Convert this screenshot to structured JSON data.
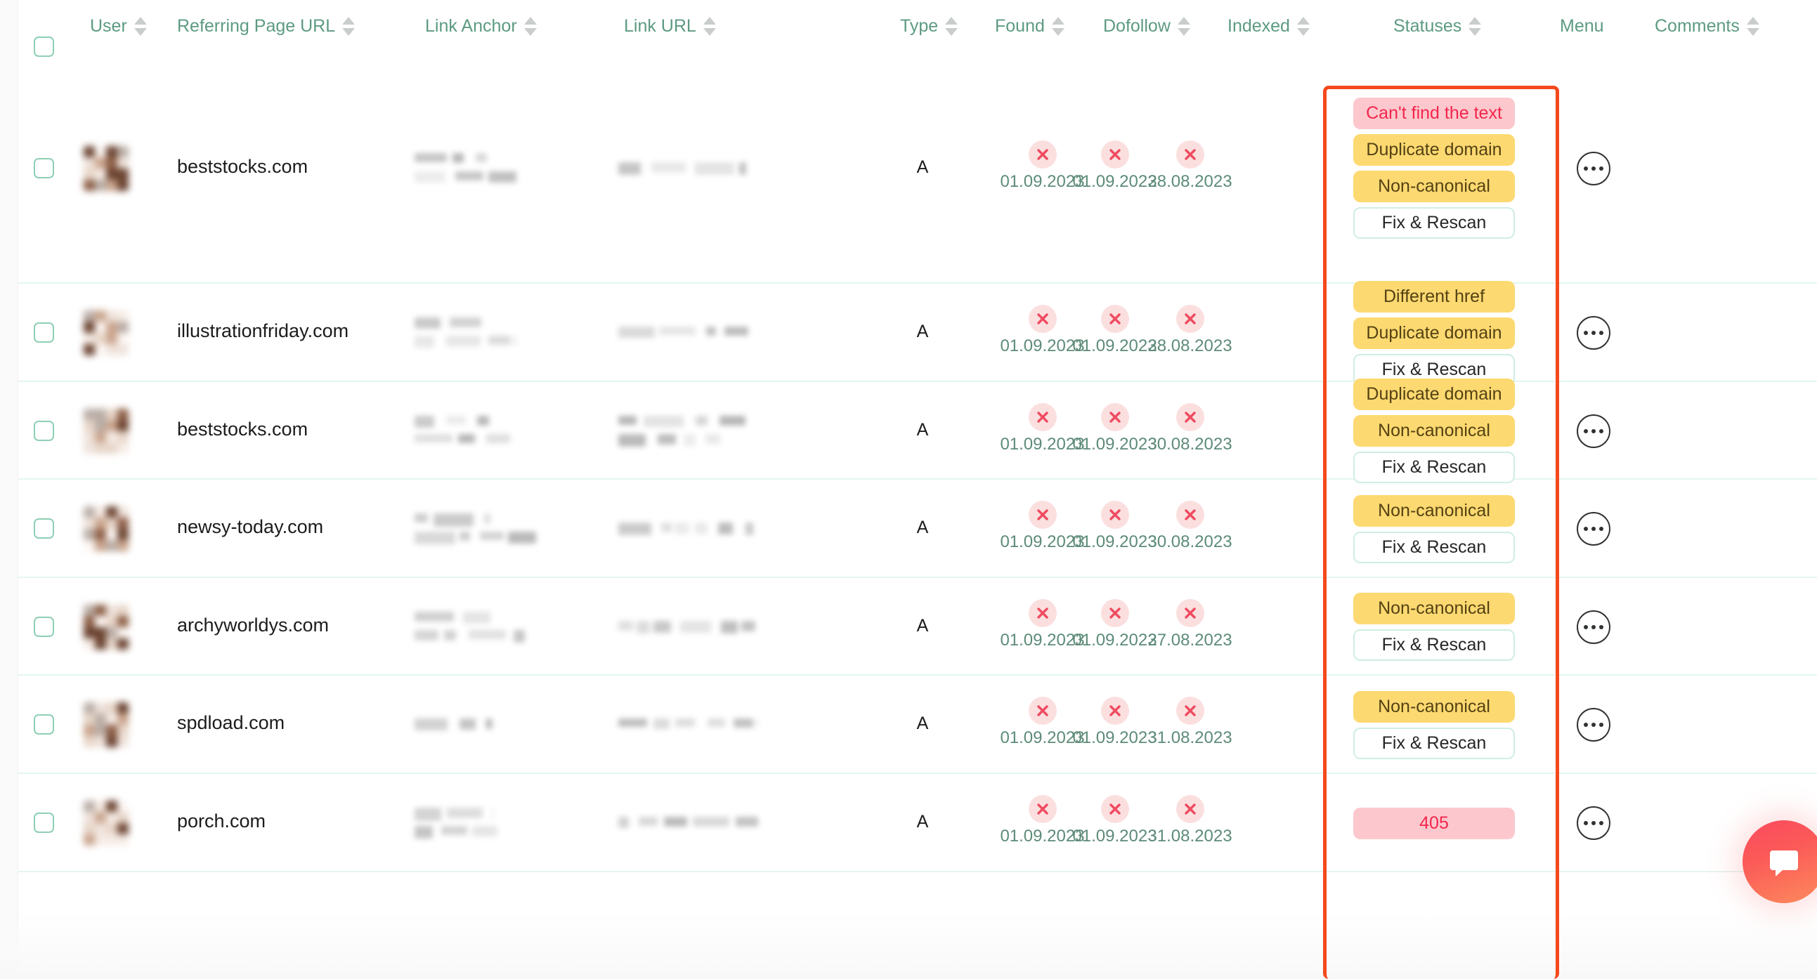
{
  "table": {
    "header": {
      "select_all_checkbox": "select-all",
      "columns": [
        {
          "label": "User",
          "sortable": true
        },
        {
          "label": "Referring Page URL",
          "sortable": true
        },
        {
          "label": "Link Anchor",
          "sortable": true
        },
        {
          "label": "Link URL",
          "sortable": true
        },
        {
          "label": "Type",
          "sortable": true
        },
        {
          "label": "Found",
          "sortable": true
        },
        {
          "label": "Dofollow",
          "sortable": true
        },
        {
          "label": "Indexed",
          "sortable": true
        },
        {
          "label": "Statuses",
          "sortable": true
        },
        {
          "label": "Menu",
          "sortable": false
        },
        {
          "label": "Comments",
          "sortable": true
        }
      ]
    },
    "rows": [
      {
        "domain": "beststocks.com",
        "type": "A",
        "found": {
          "state": "fail",
          "date": "01.09.2023"
        },
        "dofollow": {
          "state": "fail",
          "date": "01.09.2023"
        },
        "indexed": {
          "state": "fail",
          "date": "28.08.2023"
        },
        "statuses": [
          {
            "label": "Can't find the text",
            "kind": "red"
          },
          {
            "label": "Duplicate domain",
            "kind": "yellow"
          },
          {
            "label": "Non-canonical",
            "kind": "yellow"
          },
          {
            "label": "Fix & Rescan",
            "kind": "fix"
          }
        ],
        "comments": ""
      },
      {
        "domain": "illustrationfriday.com",
        "type": "A",
        "found": {
          "state": "fail",
          "date": "01.09.2023"
        },
        "dofollow": {
          "state": "fail",
          "date": "01.09.2023"
        },
        "indexed": {
          "state": "fail",
          "date": "28.08.2023"
        },
        "statuses": [
          {
            "label": "Different href",
            "kind": "yellow"
          },
          {
            "label": "Duplicate domain",
            "kind": "yellow"
          },
          {
            "label": "Fix & Rescan",
            "kind": "fix"
          }
        ],
        "comments": ""
      },
      {
        "domain": "beststocks.com",
        "type": "A",
        "found": {
          "state": "fail",
          "date": "01.09.2023"
        },
        "dofollow": {
          "state": "fail",
          "date": "01.09.2023"
        },
        "indexed": {
          "state": "fail",
          "date": "30.08.2023"
        },
        "statuses": [
          {
            "label": "Duplicate domain",
            "kind": "yellow"
          },
          {
            "label": "Non-canonical",
            "kind": "yellow"
          },
          {
            "label": "Fix & Rescan",
            "kind": "fix"
          }
        ],
        "comments": ""
      },
      {
        "domain": "newsy-today.com",
        "type": "A",
        "found": {
          "state": "fail",
          "date": "01.09.2023"
        },
        "dofollow": {
          "state": "fail",
          "date": "01.09.2023"
        },
        "indexed": {
          "state": "fail",
          "date": "30.08.2023"
        },
        "statuses": [
          {
            "label": "Non-canonical",
            "kind": "yellow"
          },
          {
            "label": "Fix & Rescan",
            "kind": "fix"
          }
        ],
        "comments": ""
      },
      {
        "domain": "archyworldys.com",
        "type": "A",
        "found": {
          "state": "fail",
          "date": "01.09.2023"
        },
        "dofollow": {
          "state": "fail",
          "date": "01.09.2023"
        },
        "indexed": {
          "state": "fail",
          "date": "27.08.2023"
        },
        "statuses": [
          {
            "label": "Non-canonical",
            "kind": "yellow"
          },
          {
            "label": "Fix & Rescan",
            "kind": "fix"
          }
        ],
        "comments": ""
      },
      {
        "domain": "spdload.com",
        "type": "A",
        "found": {
          "state": "fail",
          "date": "01.09.2023"
        },
        "dofollow": {
          "state": "fail",
          "date": "01.09.2023"
        },
        "indexed": {
          "state": "fail",
          "date": "31.08.2023"
        },
        "statuses": [
          {
            "label": "Non-canonical",
            "kind": "yellow"
          },
          {
            "label": "Fix & Rescan",
            "kind": "fix"
          }
        ],
        "comments": ""
      },
      {
        "domain": "porch.com",
        "type": "A",
        "found": {
          "state": "fail",
          "date": "01.09.2023"
        },
        "dofollow": {
          "state": "fail",
          "date": "01.09.2023"
        },
        "indexed": {
          "state": "fail",
          "date": "31.08.2023"
        },
        "statuses": [
          {
            "label": "405",
            "kind": "red"
          }
        ],
        "comments": ""
      }
    ]
  },
  "annotation": {
    "highlight_column": "Statuses",
    "color": "#f4491c"
  },
  "chat_widget": {
    "icon": "chat-bubble-icon",
    "color_start": "#fb4a5f",
    "color_end": "#fd8b5d"
  },
  "icons": {
    "sort": "sort-arrows-icon",
    "fail": "x-circle-icon",
    "menu": "ellipsis-icon",
    "checkbox": "checkbox-icon"
  },
  "colors": {
    "header_text": "#5d9b81",
    "row_divider": "#e4f6ee",
    "badge_yellow_bg": "#fdd971",
    "badge_yellow_text": "#544214",
    "badge_red_bg": "#fcc8cd",
    "badge_red_text": "#f2264d",
    "date_text": "#5d8b78",
    "checkbox_border": "#8ecfb4"
  }
}
